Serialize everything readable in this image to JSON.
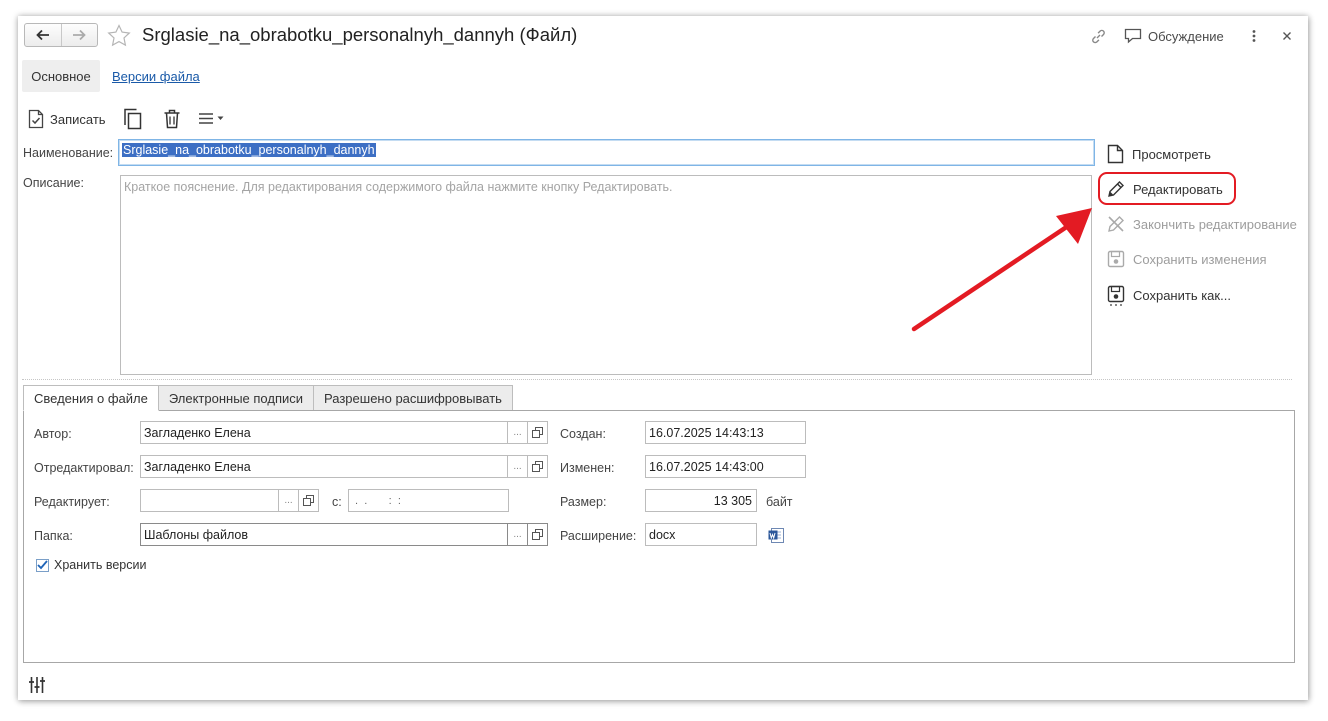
{
  "window": {
    "title": "Srglasie_na_obrabotku_personalnyh_dannyh (Файл)",
    "discussion_label": "Обсуждение"
  },
  "form_tabs": [
    {
      "label": "Основное",
      "active": true
    },
    {
      "label": "Версии файла",
      "active": false
    }
  ],
  "toolbar": {
    "save_label": "Записать"
  },
  "fields": {
    "name_label": "Наименование:",
    "name_value": "Srglasie_na_obrabotku_personalnyh_dannyh",
    "description_label": "Описание:",
    "description_placeholder": "Краткое пояснение. Для редактирования содержимого файла нажмите кнопку Редактировать."
  },
  "side_actions": [
    {
      "label": "Просмотреть",
      "icon": "document-icon",
      "enabled": true
    },
    {
      "label": "Редактировать",
      "icon": "pencil-icon",
      "enabled": true,
      "highlighted": true
    },
    {
      "label": "Закончить редактирование",
      "icon": "end-edit-icon",
      "enabled": false
    },
    {
      "label": "Сохранить изменения",
      "icon": "floppy-icon",
      "enabled": false
    },
    {
      "label": "Сохранить как...",
      "icon": "floppy-as-icon",
      "enabled": true
    }
  ],
  "bottom_tabs": [
    {
      "label": "Сведения о файле",
      "active": true
    },
    {
      "label": "Электронные подписи",
      "active": false
    },
    {
      "label": "Разрешено расшифровывать",
      "active": false
    }
  ],
  "file_info": {
    "author_label": "Автор:",
    "author_value": "Загладенко Елена",
    "edited_by_label": "Отредактировал:",
    "edited_by_value": "Загладенко Елена",
    "editing_label": "Редактирует:",
    "editing_value": "",
    "editing_since_label": "с:",
    "editing_since_value": " .  .       :  :",
    "folder_label": "Папка:",
    "folder_value": "Шаблоны файлов",
    "keep_versions_label": "Хранить версии",
    "keep_versions_checked": true,
    "created_label": "Создан:",
    "created_value": "16.07.2025 14:43:13",
    "modified_label": "Изменен:",
    "modified_value": "16.07.2025 14:43:00",
    "size_label": "Размер:",
    "size_value": "13 305",
    "size_unit": "байт",
    "extension_label": "Расширение:",
    "extension_value": "docx",
    "ellipsis": "..."
  },
  "colors": {
    "link": "#1a5aa8",
    "selection": "#3d6fc4",
    "highlight": "#e31b23",
    "disabled": "#9d9d9d"
  }
}
